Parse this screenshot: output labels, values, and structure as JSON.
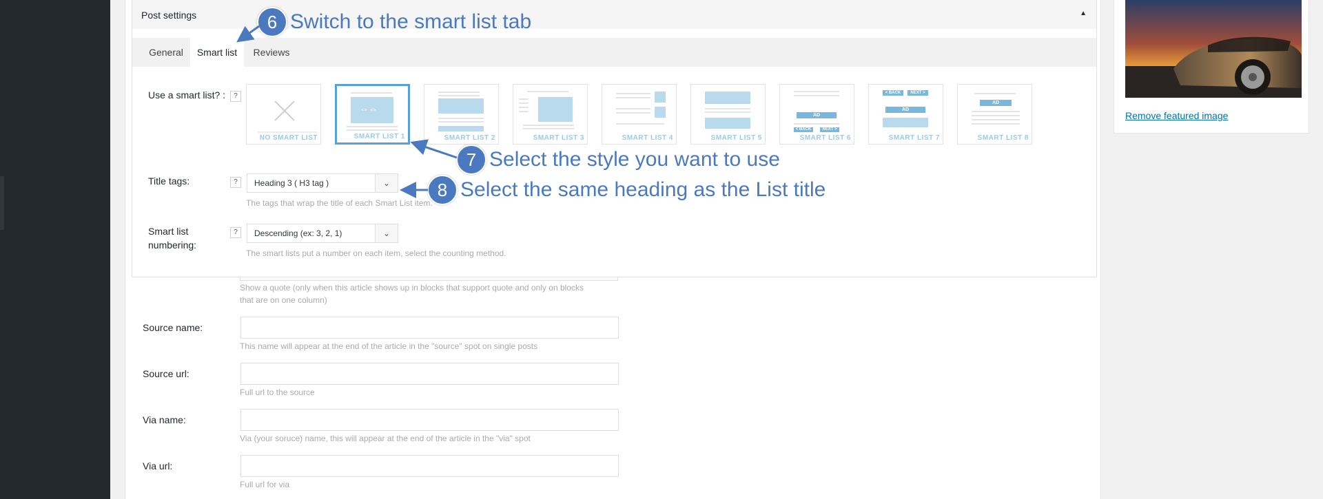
{
  "post_settings": {
    "title": "Post settings",
    "toggle_icon": "▲",
    "tabs": [
      {
        "label": "General",
        "active": false
      },
      {
        "label": "Smart list",
        "active": true
      },
      {
        "label": "Reviews",
        "active": false
      }
    ],
    "smart_list": {
      "label": "Use a smart list? :",
      "help": "?",
      "options": [
        {
          "label": "NO SMART LIST",
          "selected": false
        },
        {
          "label": "SMART LIST 1",
          "selected": true
        },
        {
          "label": "SMART LIST 2",
          "selected": false
        },
        {
          "label": "SMART LIST 3",
          "selected": false
        },
        {
          "label": "SMART LIST 4",
          "selected": false
        },
        {
          "label": "SMART LIST 5",
          "selected": false
        },
        {
          "label": "SMART LIST 6",
          "selected": false
        },
        {
          "label": "SMART LIST 7",
          "selected": false
        },
        {
          "label": "SMART LIST 8",
          "selected": false
        }
      ],
      "thumb_texts": {
        "ad": "AD",
        "back": "< BACK",
        "next": "NEXT >"
      }
    },
    "title_tags": {
      "label": "Title tags:",
      "help": "?",
      "value": "Heading 3 ( H3 tag )",
      "description": "The tags that wrap the title of each Smart List item."
    },
    "numbering": {
      "label_line1": "Smart list",
      "label_line2": "numbering:",
      "help": "?",
      "value": "Descending (ex: 3, 2, 1)",
      "description": "The smart lists put a number on each item, select the counting method."
    }
  },
  "general_fields": {
    "quote_description_line1": "Show a quote (only when this article shows up in blocks that support quote and only on blocks",
    "quote_description_line2": "that are on one column)",
    "source_name": {
      "label": "Source name:",
      "value": "",
      "description": "This name will appear at the end of the article in the \"source\" spot on single posts"
    },
    "source_url": {
      "label": "Source url:",
      "value": "",
      "description": "Full url to the source"
    },
    "via_name": {
      "label": "Via name:",
      "value": "",
      "description": "Via (your soruce) name, this will appear at the end of the article in the \"via\" spot"
    },
    "via_url": {
      "label": "Via url:",
      "value": "",
      "description": "Full url for via"
    }
  },
  "annotations": [
    {
      "number": "6",
      "text": "Switch to the smart list tab"
    },
    {
      "number": "7",
      "text": "Select the style you want to use"
    },
    {
      "number": "8",
      "text": "Select the same heading as the List title"
    }
  ],
  "featured_image": {
    "remove_link": "Remove featured image"
  },
  "colors": {
    "annotation": "#4a79c0",
    "selected_border": "#5aa0d8",
    "link": "#0073aa",
    "admin_sidebar": "#23282d"
  }
}
